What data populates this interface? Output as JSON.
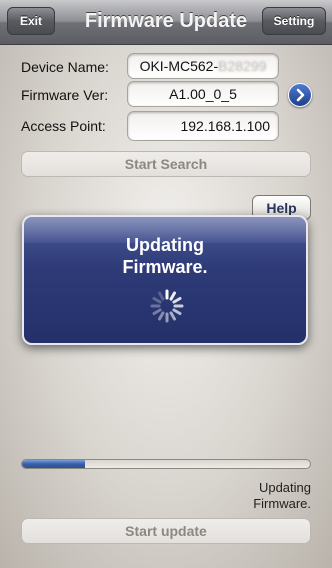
{
  "header": {
    "title": "Firmware Update",
    "exit_label": "Exit",
    "setting_label": "Setting"
  },
  "form": {
    "device_name_label": "Device Name:",
    "device_name_value": "OKI-MC562-",
    "device_name_obscured": "B28299",
    "firmware_label": "Firmware Ver:",
    "firmware_value": "A1.00_0_5",
    "access_point_label": "Access Point:",
    "access_point_value": "192.168.1.100"
  },
  "buttons": {
    "start_search": "Start Search",
    "help": "Help",
    "start_update": "Start update"
  },
  "modal": {
    "message": "Updating\nFirmware."
  },
  "progress": {
    "fraction": 0.22,
    "status_text": "Updating\nFirmware."
  },
  "icons": {
    "detail": "chevron-right-icon",
    "spinner": "activity-spinner-icon"
  },
  "colors": {
    "modal_bg": "#2e3b78",
    "progress_fill": "#3a5fa8",
    "detail_button": "#2a55b0"
  }
}
